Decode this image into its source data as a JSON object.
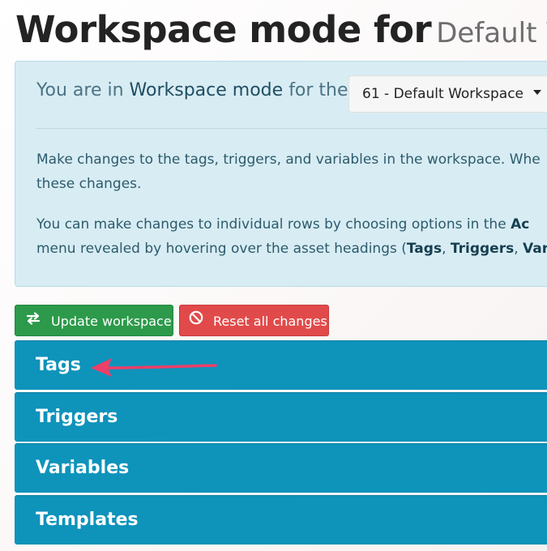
{
  "header": {
    "title": "Workspace mode for",
    "workspace_name": "Default W"
  },
  "info": {
    "mode_prefix": "You are in",
    "mode_name": "Workspace mode",
    "mode_suffix": "for the",
    "workspace_select_value": "61 - Default Workspace",
    "para1_line1": "Make changes to the tags, triggers, and variables in the workspace. Whe",
    "para1_line2": "these changes.",
    "para2_line1_prefix": "You can make changes to individual rows by choosing options in the",
    "para2_line1_bold": "Ac",
    "para2_line2_prefix": "menu revealed by hovering over the asset headings (",
    "para2_tags": "Tags",
    "para2_sep1": ", ",
    "para2_triggers": "Triggers",
    "para2_sep2": ", ",
    "para2_var": "Var"
  },
  "buttons": {
    "update_label": "Update workspace",
    "reset_label": "Reset all changes"
  },
  "sections": {
    "tags": "Tags",
    "triggers": "Triggers",
    "variables": "Variables",
    "templates": "Templates"
  },
  "colors": {
    "section_bg": "#0e93bb",
    "update_btn": "#2c9a4a",
    "reset_btn": "#e14a4a",
    "info_bg": "#d8ecf3",
    "annotation_arrow": "#ee3f68"
  },
  "icons": {
    "update": "swap-arrows-icon",
    "reset": "no-entry-icon",
    "select": "caret-down-icon",
    "annotation": "annotation-arrow-icon"
  }
}
